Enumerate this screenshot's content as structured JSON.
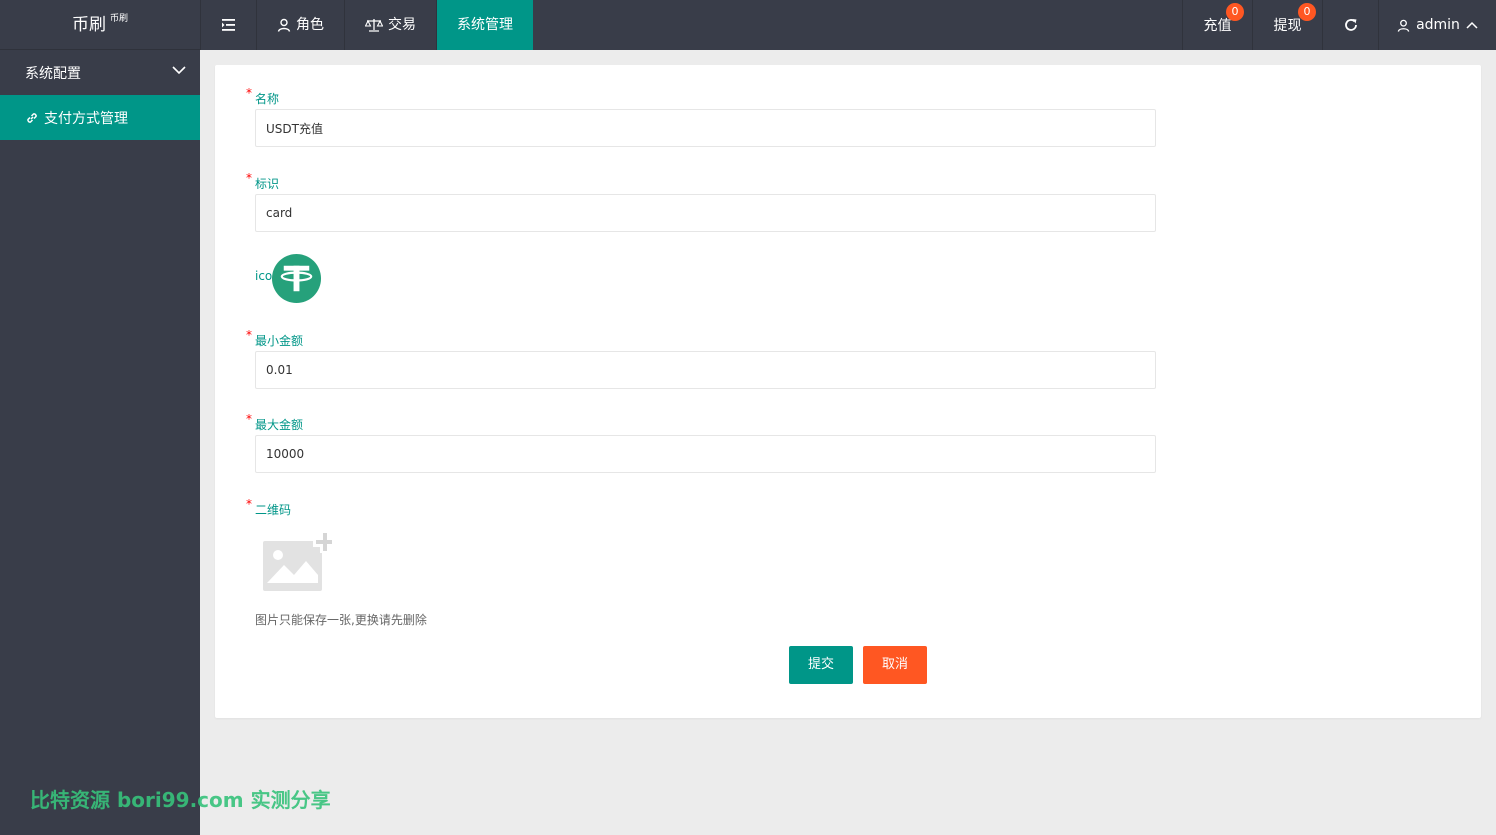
{
  "header": {
    "logo": "币刷",
    "logo_sub": "币刷",
    "nav": [
      {
        "label": "角色",
        "icon": "user-icon"
      },
      {
        "label": "交易",
        "icon": "scale-icon"
      },
      {
        "label": "系统管理",
        "icon": ""
      }
    ],
    "recharge": {
      "label": "充值",
      "badge": "0"
    },
    "withdraw": {
      "label": "提现",
      "badge": "0"
    },
    "user": "admin"
  },
  "sidebar": {
    "group": "系统配置",
    "item": "支付方式管理"
  },
  "form": {
    "name": {
      "label": "名称",
      "value": "USDT充值"
    },
    "tag": {
      "label": "标识",
      "value": "card"
    },
    "icon": {
      "label": "ico"
    },
    "min": {
      "label": "最小金额",
      "value": "0.01"
    },
    "max": {
      "label": "最大金额",
      "value": "10000"
    },
    "qrcode": {
      "label": "二维码"
    },
    "tip": "图片只能保存一张,更换请先删除",
    "submit": "提交",
    "cancel": "取消"
  },
  "watermark": "比特资源 bori99.com 实测分享",
  "colors": {
    "accent": "#009688",
    "danger": "#ff5722",
    "dark": "#393d49"
  }
}
